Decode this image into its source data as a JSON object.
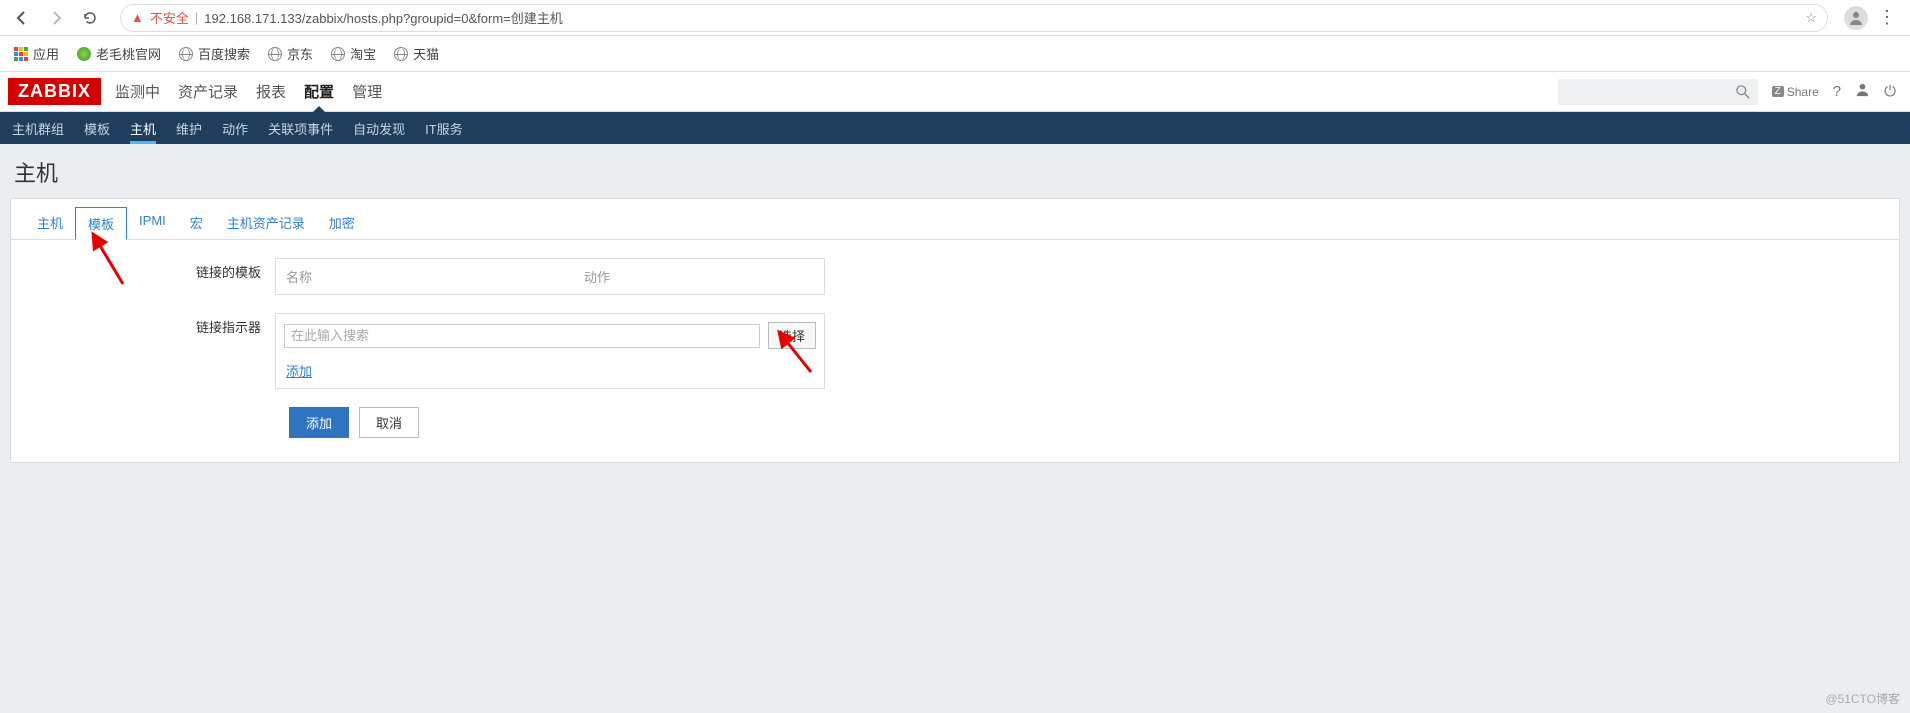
{
  "browser": {
    "insecure_label": "不安全",
    "url": "192.168.171.133/zabbix/hosts.php?groupid=0&form=创建主机"
  },
  "bookmarks": {
    "apps": "应用",
    "items": [
      "老毛桃官网",
      "百度搜索",
      "京东",
      "淘宝",
      "天猫"
    ]
  },
  "header": {
    "logo": "ZABBIX",
    "nav": [
      "监测中",
      "资产记录",
      "报表",
      "配置",
      "管理"
    ],
    "active": "配置",
    "share": "Share"
  },
  "subnav": {
    "items": [
      "主机群组",
      "模板",
      "主机",
      "维护",
      "动作",
      "关联项事件",
      "自动发现",
      "IT服务"
    ],
    "active": "主机"
  },
  "page": {
    "title": "主机",
    "tabs": [
      "主机",
      "模板",
      "IPMI",
      "宏",
      "主机资产记录",
      "加密"
    ],
    "active_tab": "模板"
  },
  "form": {
    "linked_label": "链接的模板",
    "col_name": "名称",
    "col_action": "动作",
    "linker_label": "链接指示器",
    "search_placeholder": "在此输入搜索",
    "select_btn": "选择",
    "add_link": "添加",
    "submit": "添加",
    "cancel": "取消"
  },
  "watermark": "@51CTO博客"
}
